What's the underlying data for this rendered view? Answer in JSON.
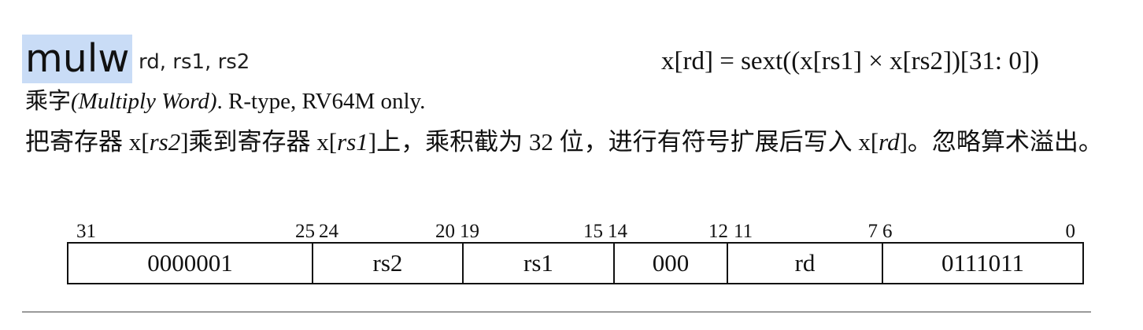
{
  "instruction": {
    "mnemonic": "mulw",
    "operands": "rd, rs1, rs2",
    "formula": "x[rd] = sext((x[rs1] × x[rs2])[31: 0])",
    "subtitle": {
      "cn_name": "乘字",
      "en_name": "(Multiply Word)",
      "rest": ". R-type, RV64M only."
    },
    "description": {
      "p1": "把寄存器 x[",
      "rs2": "rs2",
      "p2": "]乘到寄存器 x[",
      "rs1": "rs1",
      "p3": "]上，乘积截为 32 位，进行有符号扩展后写入 x[",
      "rd": "rd",
      "p4": "]。忽略算术溢出。"
    }
  },
  "encoding": {
    "bit_labels": [
      "31",
      "25",
      "24",
      "20",
      "19",
      "15",
      "14",
      "12",
      "11",
      "7",
      "6",
      "0"
    ],
    "fields": [
      "0000001",
      "rs2",
      "rs1",
      "000",
      "rd",
      "0111011"
    ]
  }
}
